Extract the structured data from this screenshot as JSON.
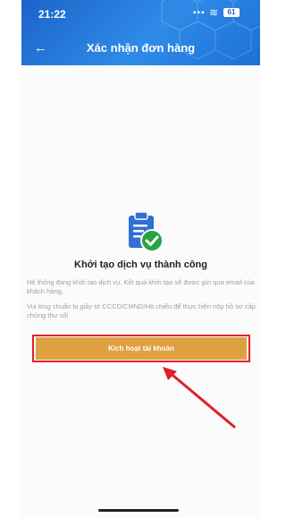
{
  "status_bar": {
    "time": "21:22",
    "battery": "61"
  },
  "header": {
    "title": "Xác nhận đơn hàng",
    "back_icon": "arrow-left-icon"
  },
  "main": {
    "icon": "clipboard-check-icon",
    "heading": "Khởi tạo dịch vụ thành công",
    "description1": "Hệ thống đang khởi tạo dịch vụ. Kết quả khởi tạo sẽ được gửi qua email của khách hàng.",
    "description2": "Vui lòng chuẩn bị giấy tờ CCCD/CMND/Hộ chiếu để thực hiện nộp hồ sơ cấp chứng thư số!",
    "button_label": "Kích hoạt tài khoản"
  },
  "colors": {
    "header": "#2477db",
    "button": "#dea040",
    "highlight": "#e0202a",
    "check": "#26a541"
  }
}
